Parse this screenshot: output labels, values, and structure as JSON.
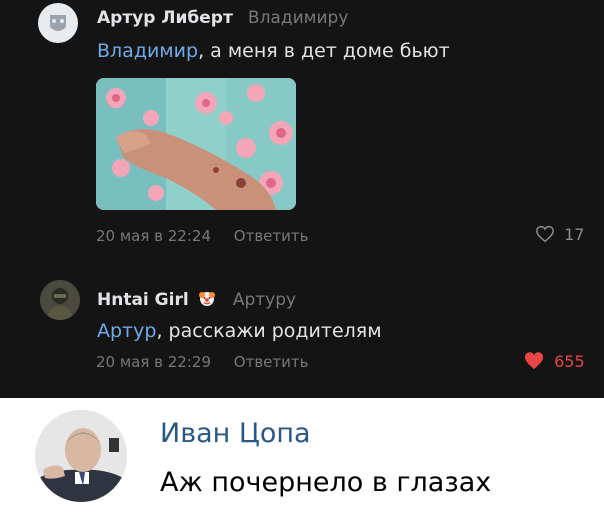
{
  "comments": [
    {
      "author": "Артур Либерт",
      "reply_to": "Владимиру",
      "mention": "Владимир",
      "text": ", а меня в дет доме бьют",
      "date": "20 мая в 22:24",
      "reply_label": "Ответить",
      "likes": "17",
      "liked": false
    },
    {
      "author": "Hntai Girl",
      "reply_to": "Артуру",
      "mention": "Артур",
      "text": ", расскажи родителям",
      "date": "20 мая в 22:29",
      "reply_label": "Ответить",
      "likes": "655",
      "liked": true
    }
  ],
  "reply": {
    "author": "Иван Цопа",
    "text": "Аж почернело в глазах"
  },
  "icons": {
    "heart_outline": "heart-outline-icon",
    "heart_filled": "heart-filled-icon",
    "clown_emoji": "clown-emoji"
  },
  "colors": {
    "dark_bg": "#141414",
    "link": "#71aaeb",
    "like_active": "#e64646",
    "name_light": "#2a5885"
  }
}
